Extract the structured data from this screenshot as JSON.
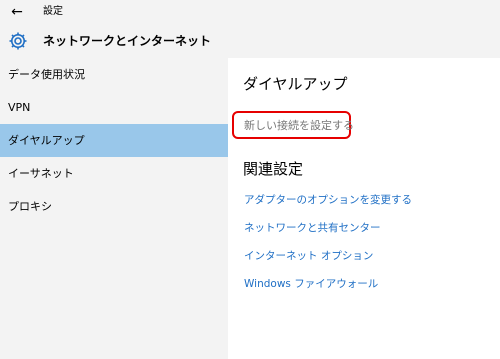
{
  "titlebar": {
    "back_icon": "back-arrow-icon",
    "title": "設定"
  },
  "header": {
    "icon": "gear-icon",
    "title": "ネットワークとインターネット",
    "accent": "#1f6fc5"
  },
  "sidebar": {
    "items": [
      {
        "label": "データ使用状況"
      },
      {
        "label": "VPN"
      },
      {
        "label": "ダイヤルアップ"
      },
      {
        "label": "イーサネット"
      },
      {
        "label": "プロキシ"
      }
    ],
    "selected_color": "#99c7ea"
  },
  "main": {
    "title": "ダイヤルアップ",
    "setup_link": "新しい接続を設定する",
    "related_title": "関連設定",
    "related_links": [
      "アダプターのオプションを変更する",
      "ネットワークと共有センター",
      "インターネット オプション",
      "Windows ファイアウォール"
    ],
    "link_color": "#1f6fc5",
    "highlight_color": "#e60000"
  }
}
